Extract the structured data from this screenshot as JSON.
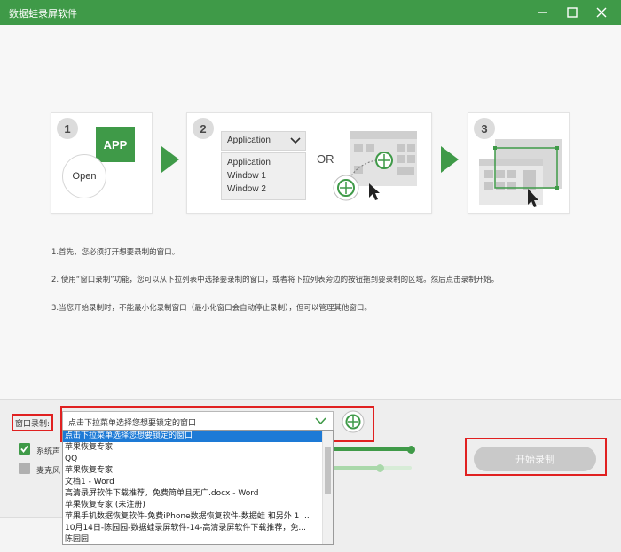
{
  "window": {
    "title": "数据蛙录屏软件",
    "accent_color": "#3f9a48",
    "controls": [
      "minimize-icon",
      "maximize-icon",
      "close-icon"
    ]
  },
  "steps": [
    {
      "number": "1",
      "app_label": "APP",
      "open_label": "Open"
    },
    {
      "number": "2",
      "select_label": "Application",
      "list_items": [
        "Application",
        "Window 1",
        "Window 2"
      ],
      "or_label": "OR"
    },
    {
      "number": "3"
    }
  ],
  "instructions": [
    "1.首先，您必须打开想要录制的窗口。",
    "2. 使用“窗口录制”功能，您可以从下拉列表中选择要录制的窗口，或者将下拉列表旁边的按钮拖到要录制的区域。然后点击录制开始。",
    "3.当您开始录制时，不能最小化录制窗口（最小化窗口会自动停止录制），但可以管理其他窗口。"
  ],
  "record": {
    "window_label": "窗口录制:",
    "combo_value": "点击下拉菜单选择您想要锁定的窗口",
    "options": [
      "点击下拉菜单选择您想要锁定的窗口",
      "苹果恢复专家",
      "QQ",
      "苹果恢复专家",
      "文档1 - Word",
      "高清录屏软件下载推荐，免费简单且无广.docx - Word",
      "苹果恢复专家 (未注册)",
      "苹果手机数据恢复软件-免费iPhone数据恢复软件-数据蛙 和另外 1 ...",
      "10月14日-陈园园-数据蛙录屏软件-14-高清录屏软件下载推荐，免...",
      "陈园园"
    ],
    "selected_index": 0,
    "system_sound": {
      "label": "系统声",
      "checked": true,
      "level": 1.0
    },
    "microphone": {
      "label": "麦克风",
      "checked": false,
      "level": 0.73
    },
    "start_button": "开始录制",
    "highlight_color": "#e02020"
  }
}
